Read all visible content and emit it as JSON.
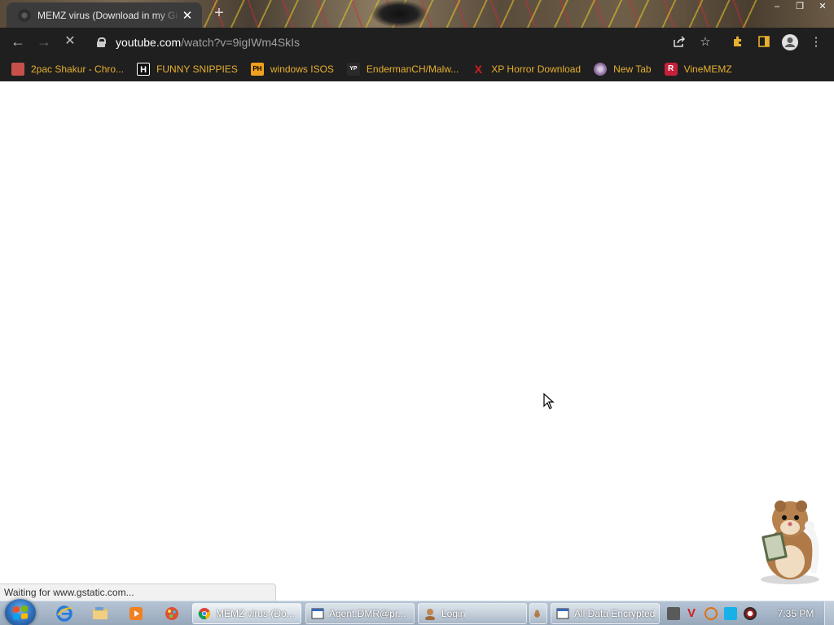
{
  "browser": {
    "tab": {
      "title": "MEMZ virus (Download in my Gi",
      "close_icon": "close-icon"
    },
    "new_tab": "+",
    "window_controls": {
      "minimize": "–",
      "restore": "❐",
      "close": "✕"
    },
    "toolbar": {
      "back": "←",
      "forward": "→",
      "reload": "✕",
      "url_host": "youtube.com",
      "url_path": "/watch?v=9igIWm4SkIs",
      "share_icon": "share-icon",
      "bookmark_star": "☆",
      "extensions_icon": "puzzle-icon",
      "sidepanel_icon": "sidepanel-icon",
      "profile_icon": "profile-icon",
      "menu": "⋮"
    },
    "bookmarks": [
      {
        "label": "2pac Shakur - Chro...",
        "icon": "photo-icon",
        "icon_text": "",
        "icon_color": "#c8504a"
      },
      {
        "label": "FUNNY SNIPPIES",
        "icon": "h-icon",
        "icon_text": "H",
        "icon_color": "#111111"
      },
      {
        "label": "windows ISOS",
        "icon": "ph-icon",
        "icon_text": "PH",
        "icon_color": "#f0a01e"
      },
      {
        "label": "EndermanCH/Malw...",
        "icon": "yp-icon",
        "icon_text": "YP",
        "icon_color": "#2a2a2a"
      },
      {
        "label": "XP Horror Download",
        "icon": "x-icon",
        "icon_text": "X",
        "icon_color": "#d02020"
      },
      {
        "label": "New Tab",
        "icon": "globe-icon",
        "icon_text": "",
        "icon_color": "#8a6a9a"
      },
      {
        "label": "VineMEMZ",
        "icon": "r-icon",
        "icon_text": "R",
        "icon_color": "#c8203a"
      }
    ]
  },
  "status_bar": {
    "text": "Waiting for www.gstatic.com..."
  },
  "taskbar": {
    "tasks": [
      {
        "label": "MEMZ virus (Do...",
        "icon": "chrome-icon",
        "active": true
      },
      {
        "label": "Agent.DMR@pr...",
        "icon": "window-icon",
        "active": false
      },
      {
        "label": "Login",
        "icon": "user-icon",
        "active": false
      },
      {
        "label": "All Data Encrypted",
        "icon": "window-icon",
        "active": false
      }
    ],
    "clock": "7:35 PM"
  }
}
